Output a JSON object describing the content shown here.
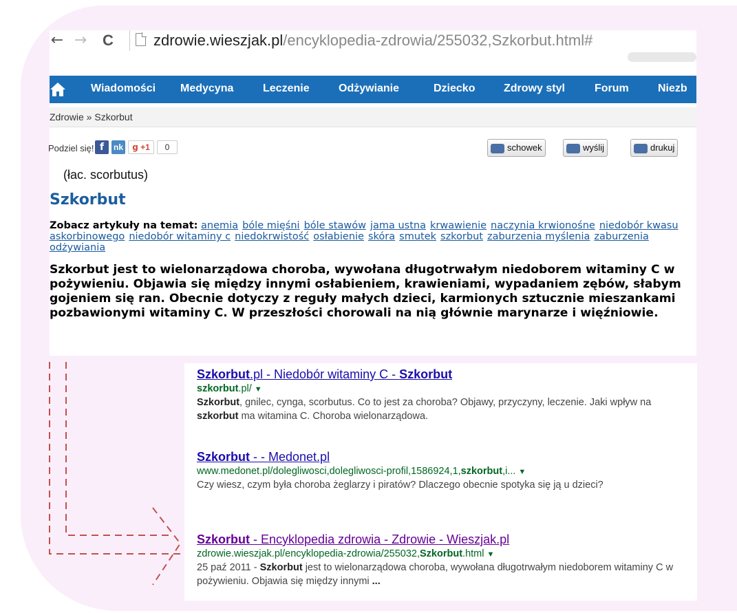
{
  "browser": {
    "url_host": "zdrowie.wieszjak.pl",
    "url_path": "/encyklopedia-zdrowia/255032,Szkorbut.html#",
    "back_glyph": "←",
    "forward_glyph": "→",
    "reload_glyph": "C"
  },
  "navbar": {
    "items": [
      "Wiadomości",
      "Medycyna",
      "Leczenie",
      "Odżywianie",
      "Dziecko",
      "Zdrowy styl",
      "Forum",
      "Niezb"
    ],
    "color": "#1b6fb8"
  },
  "breadcrumb": "Zdrowie » Szkorbut",
  "share": {
    "label": "Podziel się!",
    "fb": "f",
    "nk": "nk",
    "gplus": "+1",
    "gplus_count": "0"
  },
  "tools": {
    "schowek": "schowek",
    "wyslij": "wyślij",
    "drukuj": "drukuj"
  },
  "article": {
    "latin": "(łac. scorbutus)",
    "title": "Szkorbut",
    "topics_label": "Zobacz artykuły na temat:",
    "topics": [
      "anemia",
      "bóle mięśni",
      "bóle stawów",
      "jama ustna",
      "krwawienie",
      "naczynia krwionośne",
      "niedobór kwasu askorbinowego",
      "niedobór witaminy c",
      "niedokrwistość",
      "osłabienie",
      "skóra",
      "smutek",
      "szkorbut",
      "zaburzenia myślenia",
      "zaburzenia odżywiania"
    ],
    "body": "Szkorbut jest to wielonarządowa choroba, wywołana długotrwałym niedoborem witaminy C w pożywieniu. Objawia się między innymi osłabieniem, krawieniami, wypadaniem zębów, słabym gojeniem się ran. Obecnie dotyczy z reguły małych dzieci, karmionych sztucznie mieszankami pozbawionymi witaminy C. W przeszłości chorowali na nią głównie marynarze i więźniowie."
  },
  "results": [
    {
      "title_a": "Szkorbut",
      "title_b": ".pl - Niedobór witaminy C - ",
      "title_c": "Szkorbut",
      "url_a": "szkorbut",
      "url_b": ".pl/",
      "snippet_a": "Szkorbut",
      "snippet_b": ", gnilec, cynga, scorbutus. Co to jest za choroba? Objawy, przyczyny, leczenie. Jaki wpływ na ",
      "snippet_c": "szkorbut",
      "snippet_d": " ma witamina C. Choroba wielonarządowa."
    },
    {
      "title_a": "Szkorbut",
      "title_b": " - - Medonet.pl",
      "url_a": "www.medonet.pl/dolegliwosci,dolegliwosci-profil,1586924,1,",
      "url_b": "szkorbut",
      "url_c": ",i...",
      "snippet": "Czy wiesz, czym była choroba żeglarzy i piratów? Dlaczego obecnie spotyka się ją u dzieci?"
    },
    {
      "title_a": "Szkorbut",
      "title_b": " - Encyklopedia zdrowia - Zdrowie - Wieszjak.pl",
      "url_a": "zdrowie.wieszjak.pl/encyklopedia-zdrowia/255032,",
      "url_b": "Szkorbut",
      "url_c": ".html",
      "snippet_date": "25 paź 2011 - ",
      "snippet_a": "Szkorbut",
      "snippet_b": " jest to wielonarządowa choroba, wywołana długotrwałym niedoborem witaminy C w pożywieniu. Objawia się między innymi ",
      "snippet_c": "..."
    }
  ],
  "colors": {
    "background_frame": "#fbeefb",
    "link": "#1a0dab",
    "visited": "#609",
    "green_url": "#006621",
    "arrow": "#c0504d"
  }
}
